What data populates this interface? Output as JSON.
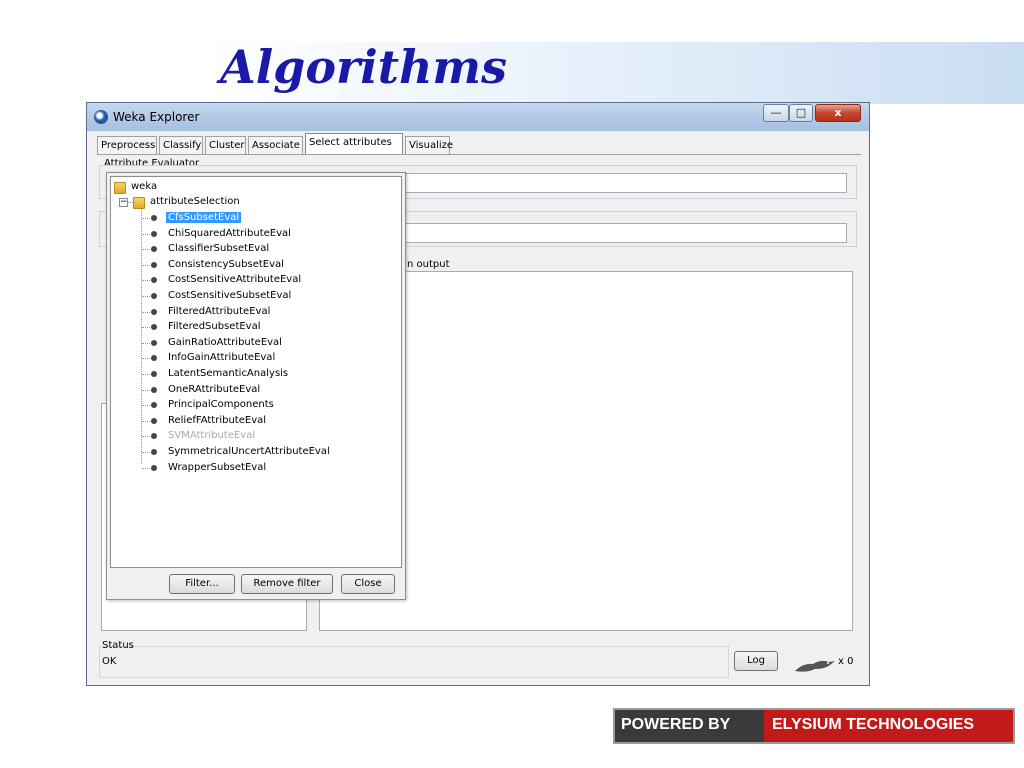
{
  "slide": {
    "title": "Algorithms"
  },
  "window": {
    "title": "Weka Explorer",
    "buttons": {
      "minimize": "—",
      "maximize": "□",
      "close": "x"
    }
  },
  "tabs": [
    "Preprocess",
    "Classify",
    "Cluster",
    "Associate",
    "Select attributes",
    "Visualize"
  ],
  "active_tab": "Select attributes",
  "panel": {
    "attribute_evaluator_label": "Attribute Evaluator",
    "output_label": "n output",
    "status_label": "Status",
    "status_text": "OK",
    "log_button": "Log",
    "task_count": "x 0"
  },
  "tree": {
    "root": "weka",
    "folder": "attributeSelection",
    "items": [
      "CfsSubsetEval",
      "ChiSquaredAttributeEval",
      "ClassifierSubsetEval",
      "ConsistencySubsetEval",
      "CostSensitiveAttributeEval",
      "CostSensitiveSubsetEval",
      "FilteredAttributeEval",
      "FilteredSubsetEval",
      "GainRatioAttributeEval",
      "InfoGainAttributeEval",
      "LatentSemanticAnalysis",
      "OneRAttributeEval",
      "PrincipalComponents",
      "ReliefFAttributeEval",
      "SVMAttributeEval",
      "SymmetricalUncertAttributeEval",
      "WrapperSubsetEval"
    ],
    "selected_item": "CfsSubsetEval",
    "disabled_item": "SVMAttributeEval"
  },
  "popup_buttons": {
    "filter": "Filter...",
    "remove_filter": "Remove filter",
    "close": "Close"
  },
  "branding": {
    "powered_by": "POWERED BY",
    "company": "ELYSIUM TECHNOLOGIES"
  },
  "colors": {
    "title": "#1a1aa8",
    "selection": "#3399ff",
    "brand_red": "#c21a1a"
  }
}
